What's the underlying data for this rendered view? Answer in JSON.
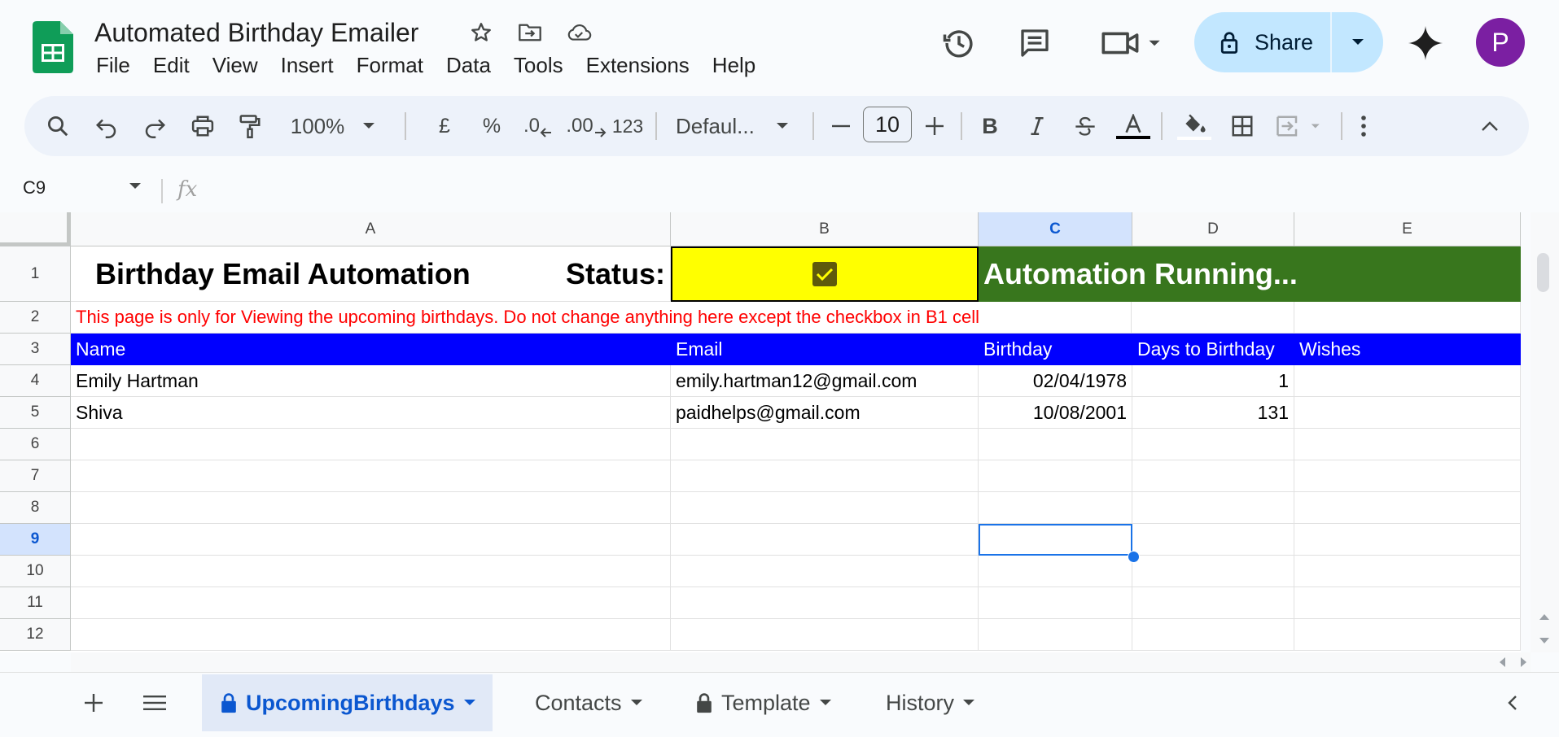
{
  "header": {
    "title": "Automated Birthday Emailer",
    "menu": [
      "File",
      "Edit",
      "View",
      "Insert",
      "Format",
      "Data",
      "Tools",
      "Extensions",
      "Help"
    ],
    "share_label": "Share",
    "avatar_initial": "P"
  },
  "toolbar": {
    "zoom": "100%",
    "currency": "£",
    "percent": "%",
    "dec_decrease": ".0",
    "dec_increase": ".00",
    "format_123": "123",
    "font": "Defaul...",
    "font_size": "10"
  },
  "formula_bar": {
    "cell_ref": "C9",
    "fx": "fx",
    "content": ""
  },
  "sheet": {
    "columns": [
      "A",
      "B",
      "C",
      "D",
      "E"
    ],
    "selected_column": "C",
    "rows": [
      "1",
      "2",
      "3",
      "4",
      "5",
      "6",
      "7",
      "8",
      "9",
      "10",
      "11",
      "12"
    ],
    "selected_row": "9",
    "r1": {
      "title": "Birthday Email Automation",
      "status_label": "Status:",
      "checkbox_checked": true,
      "running_text": "Automation Running..."
    },
    "r2_note": "This page is only for Viewing the upcoming birthdays. Do not change anything here except the checkbox in B1 cell",
    "table_headers": [
      "Name",
      "Email",
      "Birthday",
      "Days to Birthday",
      "Wishes"
    ],
    "table_rows": [
      {
        "name": "Emily Hartman",
        "email": "emily.hartman12@gmail.com",
        "birthday": "02/04/1978",
        "days": "1",
        "wishes": ""
      },
      {
        "name": "Shiva",
        "email": "paidhelps@gmail.com",
        "birthday": "10/08/2001",
        "days": "131",
        "wishes": ""
      }
    ]
  },
  "tabs": [
    {
      "label": "UpcomingBirthdays",
      "locked": true,
      "active": true
    },
    {
      "label": "Contacts",
      "locked": false,
      "active": false
    },
    {
      "label": "Template",
      "locked": true,
      "active": false
    },
    {
      "label": "History",
      "locked": false,
      "active": false
    }
  ],
  "colors": {
    "title_yellow": "#ffff00",
    "running_green": "#38761d",
    "header_blue": "#0000ff",
    "note_red": "#ff0000",
    "accent": "#0b57d0"
  }
}
